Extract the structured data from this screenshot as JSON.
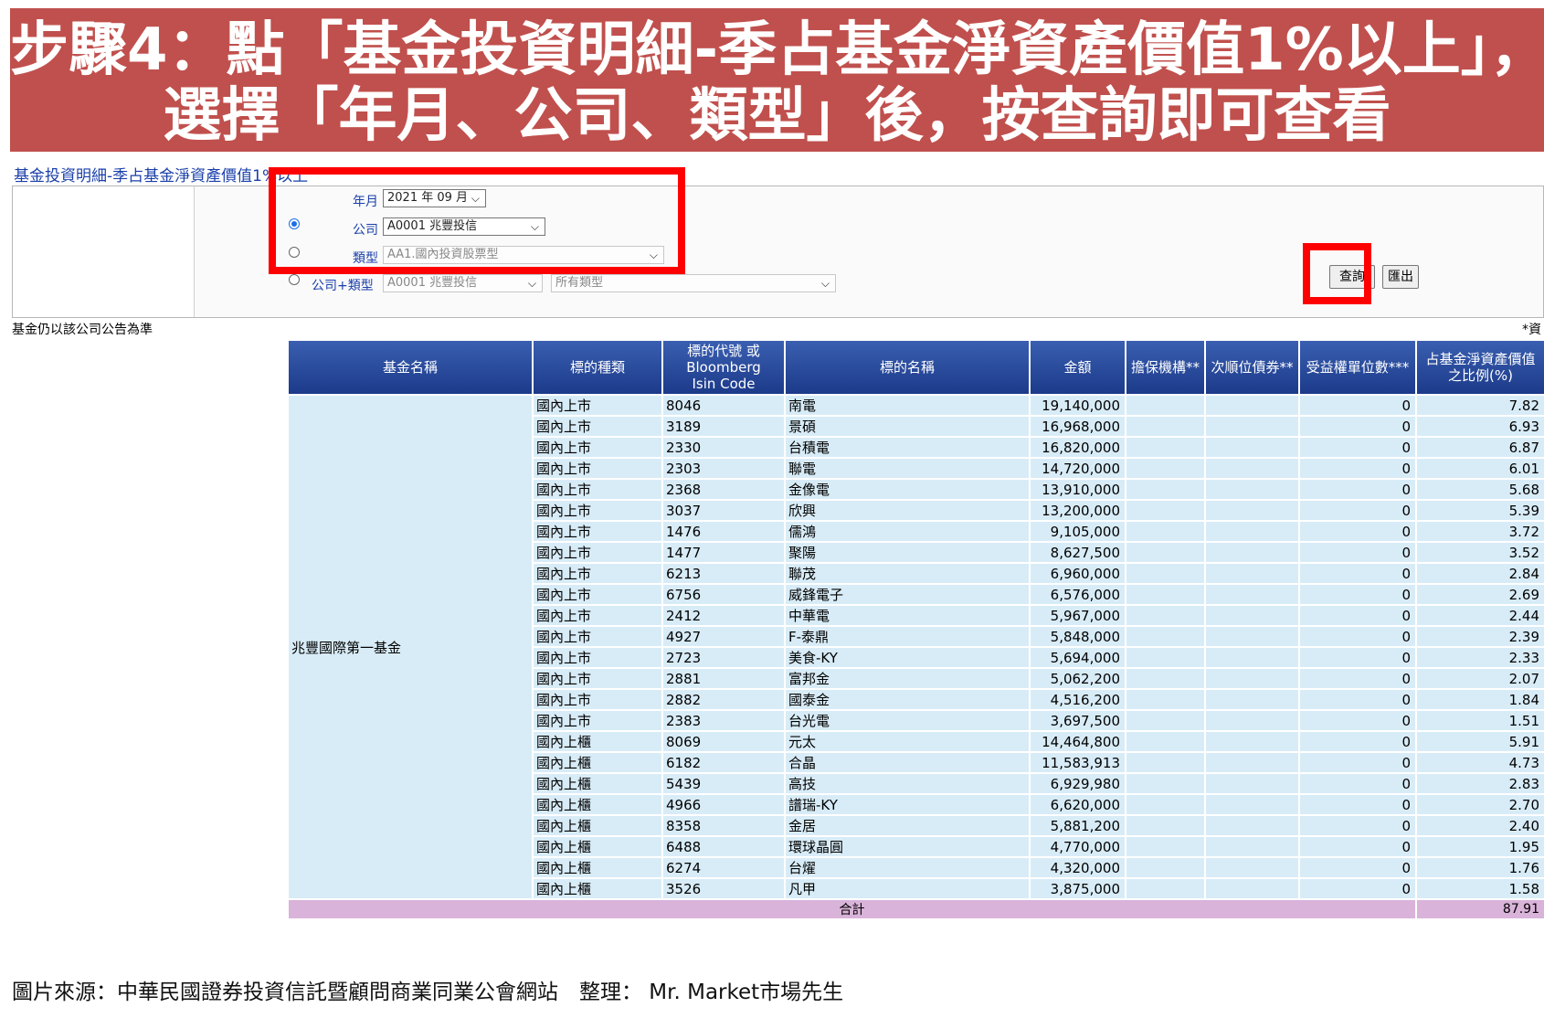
{
  "banner": {
    "line1": "步驟4：點「基金投資明細-季占基金淨資產價值1%以上」，",
    "line2": "選擇「年月、公司、類型」後，按查詢即可查看"
  },
  "page_link": "基金投資明細-季占基金淨資產價值1%以上",
  "form": {
    "year_month_label": "年月",
    "year_month_value": "2021 年 09 月",
    "company_label": "公司",
    "company_value": "A0001 兆豐投信",
    "type_label": "類型",
    "type_value": "AA1.國內投資股票型",
    "company_type_label": "公司+類型",
    "company_type_company": "A0001 兆豐投信",
    "company_type_type": "所有類型",
    "query_button": "查詢",
    "export_button": "匯出"
  },
  "note_left": "基金仍以該公司公告為準",
  "note_right": "*資",
  "table": {
    "headers": [
      "基金名稱",
      "標的種類",
      "標的代號 或\nBloomberg\nIsin Code",
      "標的名稱",
      "金額",
      "擔保機構**",
      "次順位債券**",
      "受益權單位數***",
      "占基金淨資產價值\n之比例(%)"
    ],
    "fund_name": "兆豐國際第一基金",
    "rows": [
      [
        "國內上市",
        "8046",
        "南電",
        "19,140,000",
        "",
        "",
        "0",
        "7.82"
      ],
      [
        "國內上市",
        "3189",
        "景碩",
        "16,968,000",
        "",
        "",
        "0",
        "6.93"
      ],
      [
        "國內上市",
        "2330",
        "台積電",
        "16,820,000",
        "",
        "",
        "0",
        "6.87"
      ],
      [
        "國內上市",
        "2303",
        "聯電",
        "14,720,000",
        "",
        "",
        "0",
        "6.01"
      ],
      [
        "國內上市",
        "2368",
        "金像電",
        "13,910,000",
        "",
        "",
        "0",
        "5.68"
      ],
      [
        "國內上市",
        "3037",
        "欣興",
        "13,200,000",
        "",
        "",
        "0",
        "5.39"
      ],
      [
        "國內上市",
        "1476",
        "儒鴻",
        "9,105,000",
        "",
        "",
        "0",
        "3.72"
      ],
      [
        "國內上市",
        "1477",
        "聚陽",
        "8,627,500",
        "",
        "",
        "0",
        "3.52"
      ],
      [
        "國內上市",
        "6213",
        "聯茂",
        "6,960,000",
        "",
        "",
        "0",
        "2.84"
      ],
      [
        "國內上市",
        "6756",
        "威鋒電子",
        "6,576,000",
        "",
        "",
        "0",
        "2.69"
      ],
      [
        "國內上市",
        "2412",
        "中華電",
        "5,967,000",
        "",
        "",
        "0",
        "2.44"
      ],
      [
        "國內上市",
        "4927",
        "F-泰鼎",
        "5,848,000",
        "",
        "",
        "0",
        "2.39"
      ],
      [
        "國內上市",
        "2723",
        "美食-KY",
        "5,694,000",
        "",
        "",
        "0",
        "2.33"
      ],
      [
        "國內上市",
        "2881",
        "富邦金",
        "5,062,200",
        "",
        "",
        "0",
        "2.07"
      ],
      [
        "國內上市",
        "2882",
        "國泰金",
        "4,516,200",
        "",
        "",
        "0",
        "1.84"
      ],
      [
        "國內上市",
        "2383",
        "台光電",
        "3,697,500",
        "",
        "",
        "0",
        "1.51"
      ],
      [
        "國內上櫃",
        "8069",
        "元太",
        "14,464,800",
        "",
        "",
        "0",
        "5.91"
      ],
      [
        "國內上櫃",
        "6182",
        "合晶",
        "11,583,913",
        "",
        "",
        "0",
        "4.73"
      ],
      [
        "國內上櫃",
        "5439",
        "高技",
        "6,929,980",
        "",
        "",
        "0",
        "2.83"
      ],
      [
        "國內上櫃",
        "4966",
        "譜瑞-KY",
        "6,620,000",
        "",
        "",
        "0",
        "2.70"
      ],
      [
        "國內上櫃",
        "8358",
        "金居",
        "5,881,200",
        "",
        "",
        "0",
        "2.40"
      ],
      [
        "國內上櫃",
        "6488",
        "環球晶圓",
        "4,770,000",
        "",
        "",
        "0",
        "1.95"
      ],
      [
        "國內上櫃",
        "6274",
        "台燿",
        "4,320,000",
        "",
        "",
        "0",
        "1.76"
      ],
      [
        "國內上櫃",
        "3526",
        "凡甲",
        "3,875,000",
        "",
        "",
        "0",
        "1.58"
      ]
    ],
    "total_label": "合計",
    "total_value": "87.91"
  },
  "source": "圖片來源：中華民國證券投資信託暨顧問商業同業公會網站　整理：  Mr. Market市場先生"
}
